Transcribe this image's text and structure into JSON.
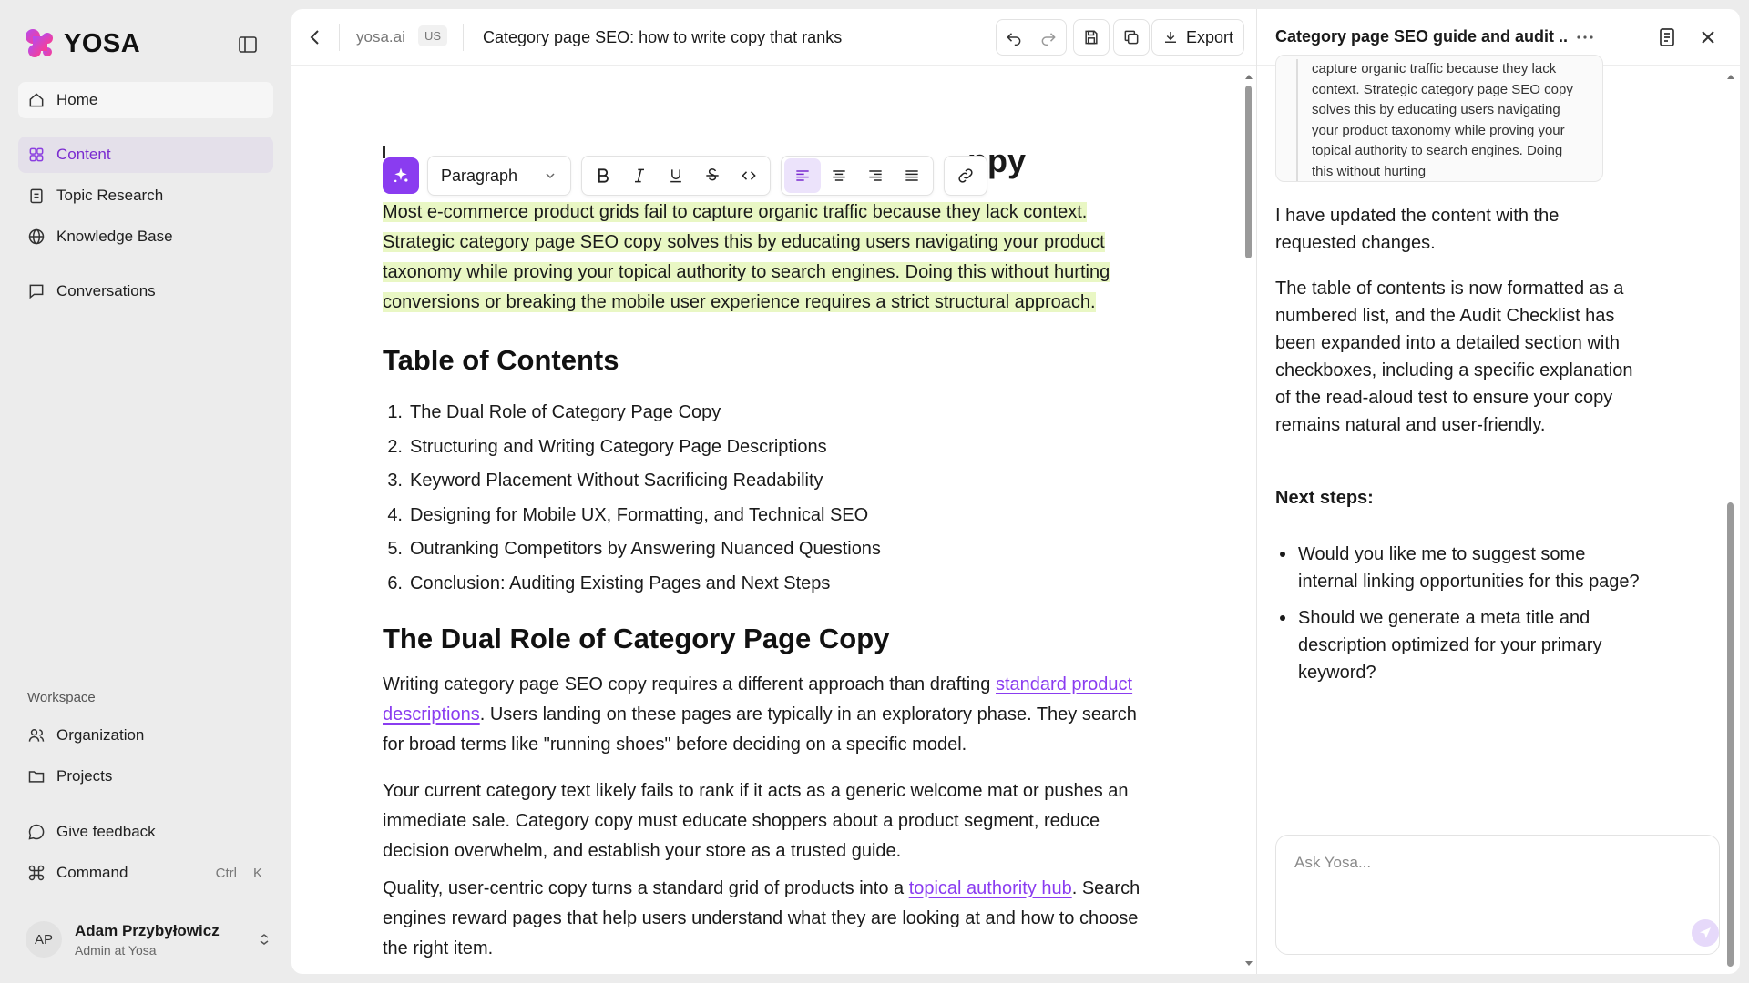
{
  "brand": {
    "name": "YOSA"
  },
  "sidebar": {
    "nav": [
      {
        "label": "Home",
        "icon": "home-icon"
      },
      {
        "label": "Content",
        "icon": "content-icon"
      },
      {
        "label": "Topic Research",
        "icon": "clipboard-icon"
      },
      {
        "label": "Knowledge Base",
        "icon": "globe-icon"
      },
      {
        "label": "Conversations",
        "icon": "chat-icon"
      }
    ],
    "workspace_label": "Workspace",
    "workspace": [
      {
        "label": "Organization",
        "icon": "users-icon"
      },
      {
        "label": "Projects",
        "icon": "folder-icon"
      }
    ],
    "footer": [
      {
        "label": "Give feedback",
        "icon": "feedback-icon"
      },
      {
        "label": "Command",
        "icon": "command-icon",
        "shortcut": [
          "Ctrl",
          "K"
        ]
      }
    ],
    "user": {
      "initials": "AP",
      "name": "Adam Przybyłowicz",
      "role": "Admin at Yosa"
    }
  },
  "editor": {
    "site": "yosa.ai",
    "country": "US",
    "doc_title": "Category page SEO: how to write copy that ranks",
    "export_label": "Export",
    "title_fragment": "ppy",
    "format": {
      "block_type": "Paragraph"
    },
    "intro": "Most e-commerce product grids fail to capture organic traffic because they lack context. Strategic category page SEO copy solves this by educating users navigating your product taxonomy while proving your topical authority to search engines. Doing this without hurting conversions or breaking the mobile user experience requires a strict structural approach.",
    "toc_heading": "Table of Contents",
    "toc": [
      "The Dual Role of Category Page Copy",
      "Structuring and Writing Category Page Descriptions",
      "Keyword Placement Without Sacrificing Readability",
      "Designing for Mobile UX, Formatting, and Technical SEO",
      "Outranking Competitors by Answering Nuanced Questions",
      "Conclusion: Auditing Existing Pages and Next Steps"
    ],
    "section_heading": "The Dual Role of Category Page Copy",
    "para1": {
      "before": "Writing category page SEO copy requires a different approach than drafting ",
      "link": "standard product descriptions",
      "after": ". Users landing on these pages are typically in an exploratory phase. They search for broad terms like \"running shoes\" before deciding on a specific model."
    },
    "para2": "Your current category text likely fails to rank if it acts as a generic welcome mat or pushes an immediate sale. Category copy must educate shoppers about a product segment, reduce decision overwhelm, and establish your store as a trusted guide.",
    "para3": {
      "before": "Quality, user-centric copy turns a standard grid of products into a ",
      "link": "topical authority hub",
      "after": ". Search engines reward pages that help users understand what they are looking at and how to choose the right item."
    }
  },
  "chat": {
    "title": "Category page SEO guide and audit ...",
    "quote": "capture organic traffic because they lack context. Strategic category page SEO copy solves this by educating users navigating your product taxonomy while proving your topical authority to search engines. Doing this without hurting",
    "msg1": "I have updated the content with the requested changes.",
    "msg2": "The table of contents is now formatted as a numbered list, and the Audit Checklist has been expanded into a detailed section with checkboxes, including a specific explanation of the read-aloud test to ensure your copy remains natural and user-friendly.",
    "next_steps_label": "Next steps:",
    "next_steps": [
      "Would you like me to suggest some internal linking opportunities for this page?",
      "Should we generate a meta title and description optimized for your primary keyword?"
    ],
    "input_placeholder": "Ask Yosa..."
  },
  "colors": {
    "accent": "#8a3cf0",
    "highlight": "#e9f7c4",
    "active_nav_bg": "#e4e0ea"
  }
}
